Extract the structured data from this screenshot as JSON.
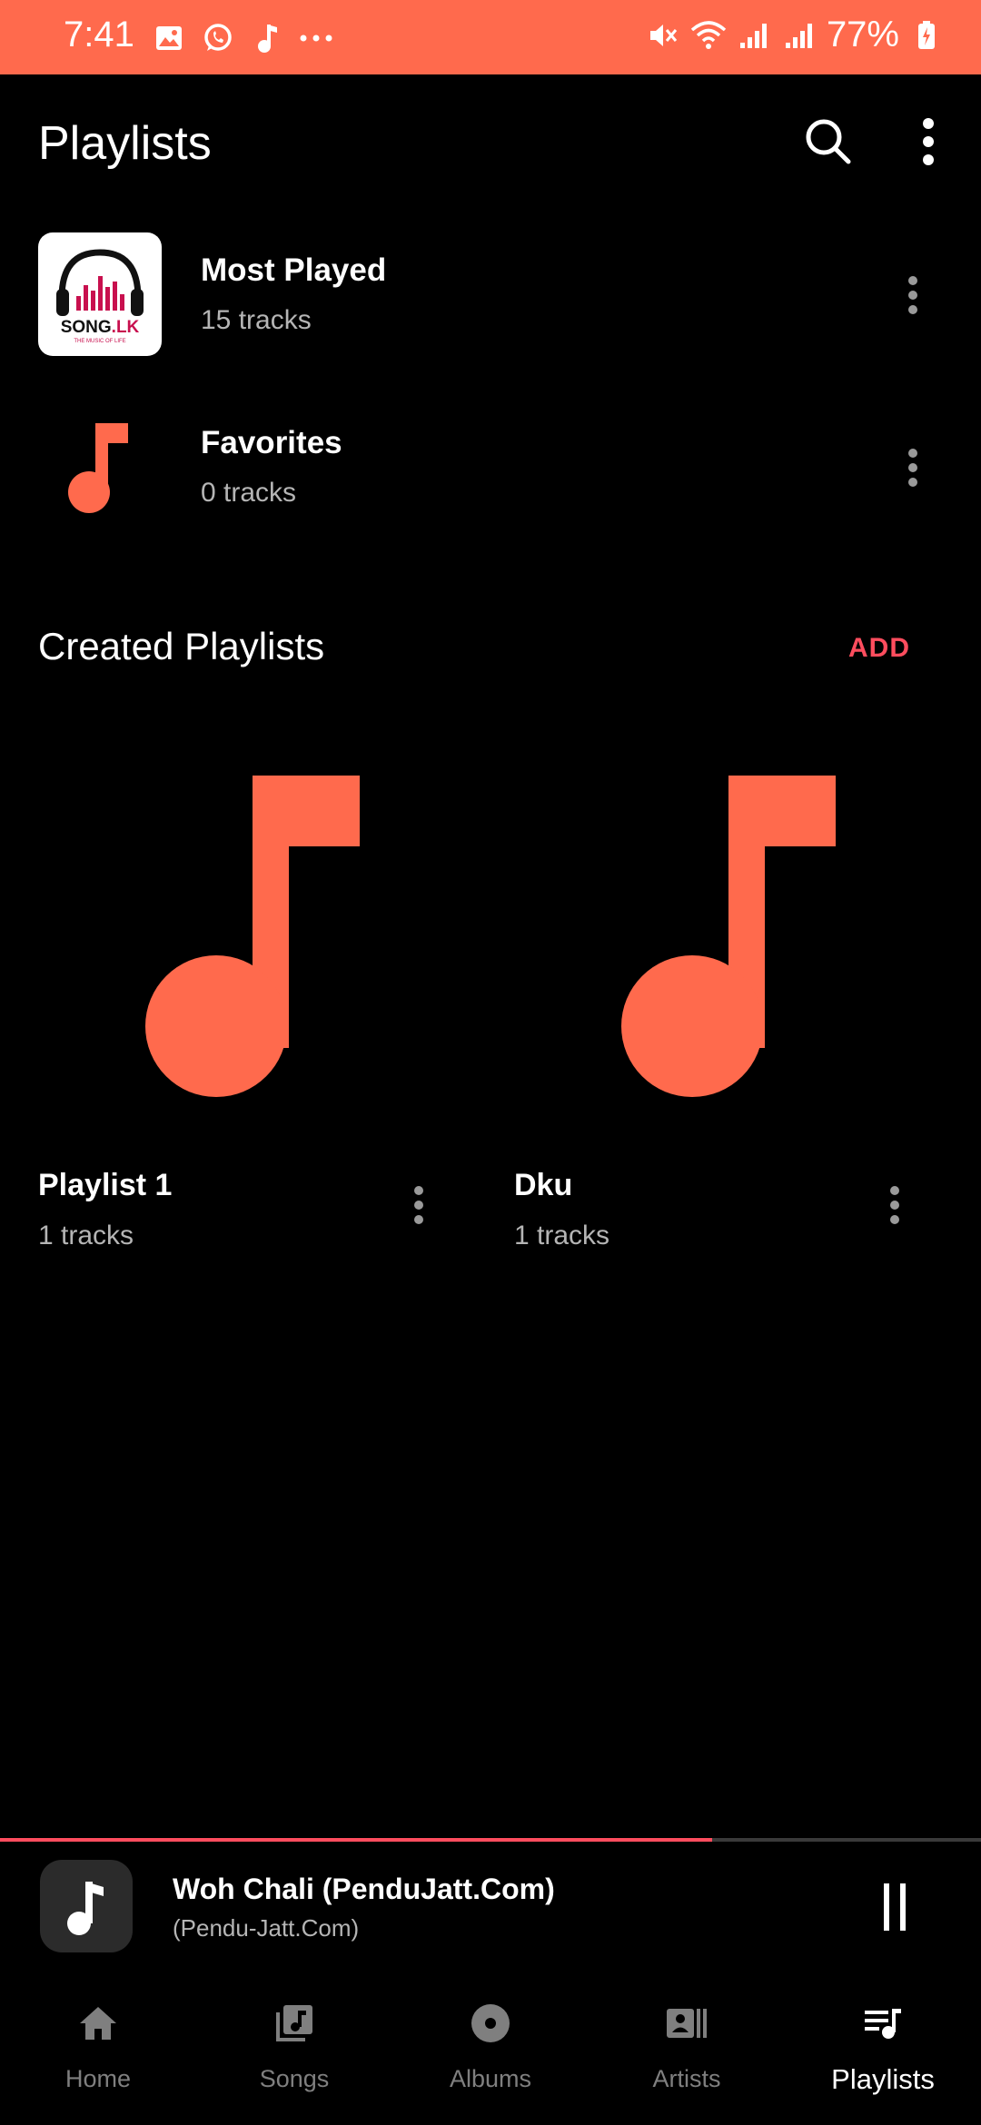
{
  "status_bar": {
    "time": "7:41",
    "battery": "77%",
    "icons_left": [
      "gallery-icon",
      "whatsapp-icon",
      "music-note-icon",
      "more-dots-icon"
    ],
    "icons_right": [
      "mute-icon",
      "wifi-icon",
      "signal-icon",
      "signal-icon",
      "battery-charging-icon"
    ]
  },
  "header": {
    "title": "Playlists",
    "search_icon": "search-icon",
    "menu_icon": "more-vert-icon"
  },
  "auto_playlists": [
    {
      "title": "Most Played",
      "subtitle": "15 tracks",
      "art_logo_text": "SONG.LK",
      "art_logo_tagline": "THE MUSIC OF LIFE"
    },
    {
      "title": "Favorites",
      "subtitle": "0 tracks"
    }
  ],
  "created_section": {
    "title": "Created Playlists",
    "add_label": "ADD"
  },
  "created_playlists": [
    {
      "title": "Playlist 1",
      "subtitle": "1 tracks"
    },
    {
      "title": "Dku",
      "subtitle": "1 tracks"
    }
  ],
  "now_playing": {
    "title": "Woh Chali (PenduJatt.Com)",
    "artist": "(Pendu-Jatt.Com)",
    "progress": 0.726,
    "state_icon": "pause-icon"
  },
  "bottom_nav": [
    {
      "label": "Home",
      "icon": "home-icon",
      "active": false
    },
    {
      "label": "Songs",
      "icon": "songs-icon",
      "active": false
    },
    {
      "label": "Albums",
      "icon": "album-icon",
      "active": false
    },
    {
      "label": "Artists",
      "icon": "artist-icon",
      "active": false
    },
    {
      "label": "Playlists",
      "icon": "playlist-icon",
      "active": true
    }
  ],
  "colors": {
    "accent": "#FF6A4D",
    "accent_text": "#FF4D5E",
    "background": "#000000",
    "secondary_text": "#B5B5B5",
    "inactive_nav": "#7F7F7F"
  }
}
